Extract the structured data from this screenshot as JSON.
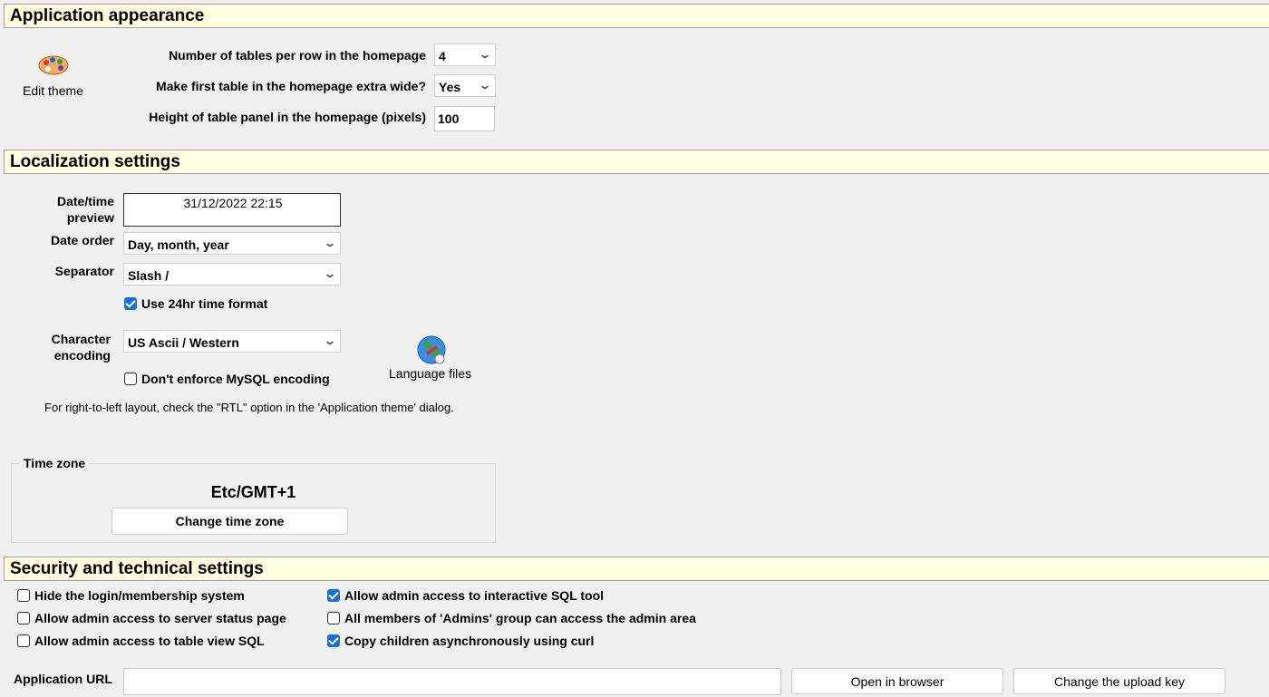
{
  "appearance": {
    "header": "Application appearance",
    "edit_theme_label": "Edit theme",
    "tables_per_row_label": "Number of tables per row in the homepage",
    "tables_per_row_value": "4",
    "extra_wide_label": "Make first table in the homepage extra wide?",
    "extra_wide_value": "Yes",
    "panel_height_label": "Height of table panel in the homepage (pixels)",
    "panel_height_value": "100"
  },
  "localization": {
    "header": "Localization settings",
    "datetime_preview_label": "Date/time preview",
    "datetime_preview_value": "31/12/2022 22:15",
    "date_order_label": "Date order",
    "date_order_value": "Day, month, year",
    "separator_label": "Separator",
    "separator_value": "Slash /",
    "use_24hr_label": "Use 24hr time format",
    "use_24hr_checked": true,
    "char_encoding_label": "Character encoding",
    "char_encoding_value": "US Ascii / Western",
    "dont_enforce_label": "Don't enforce MySQL encoding",
    "dont_enforce_checked": false,
    "language_files_label": "Language files",
    "rtl_note": "For right-to-left layout, check the \"RTL\" option in the 'Application theme' dialog."
  },
  "timezone": {
    "legend": "Time zone",
    "value": "Etc/GMT+1",
    "change_button": "Change time zone"
  },
  "security": {
    "header": "Security and technical settings",
    "options": [
      {
        "label": "Hide the login/membership system",
        "checked": false
      },
      {
        "label": "Allow admin access to server status page",
        "checked": false
      },
      {
        "label": "Allow admin access to table view SQL",
        "checked": false
      },
      {
        "label": "Allow admin access to interactive SQL tool",
        "checked": true
      },
      {
        "label": "All members of 'Admins' group can access the admin area",
        "checked": false
      },
      {
        "label": "Copy children asynchronously using curl",
        "checked": true
      }
    ],
    "app_url_label": "Application URL",
    "app_url_value": "",
    "open_browser_button": "Open in browser",
    "change_upload_key_button": "Change the upload key"
  }
}
